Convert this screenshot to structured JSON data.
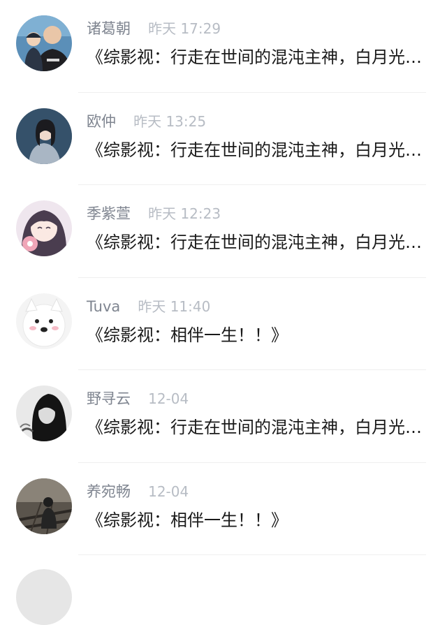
{
  "comments": [
    {
      "name": "诸葛朝",
      "time": "昨天 17:29",
      "message": "《综影视：行走在世间的混沌主神，白月光…",
      "avatar": "parent-with-baby-photo"
    },
    {
      "name": "欧仲",
      "time": "昨天 13:25",
      "message": "《综影视：行走在世间的混沌主神，白月光…",
      "avatar": "girl-portrait-photo"
    },
    {
      "name": "季紫萱",
      "time": "昨天 12:23",
      "message": "《综影视：行走在世间的混沌主神，白月光…",
      "avatar": "anime-girl-illustration"
    },
    {
      "name": "Tuva",
      "time": "昨天 11:40",
      "message": "《综影视：相伴一生！！》",
      "avatar": "samoyed-dog-photo"
    },
    {
      "name": "野寻云",
      "time": "12-04",
      "message": "《综影视：行走在世间的混沌主神，白月光…",
      "avatar": "dark-hair-woman-sketch"
    },
    {
      "name": "养宛畅",
      "time": "12-04",
      "message": "《综影视：相伴一生！！》",
      "avatar": "person-on-railway-photo"
    }
  ]
}
